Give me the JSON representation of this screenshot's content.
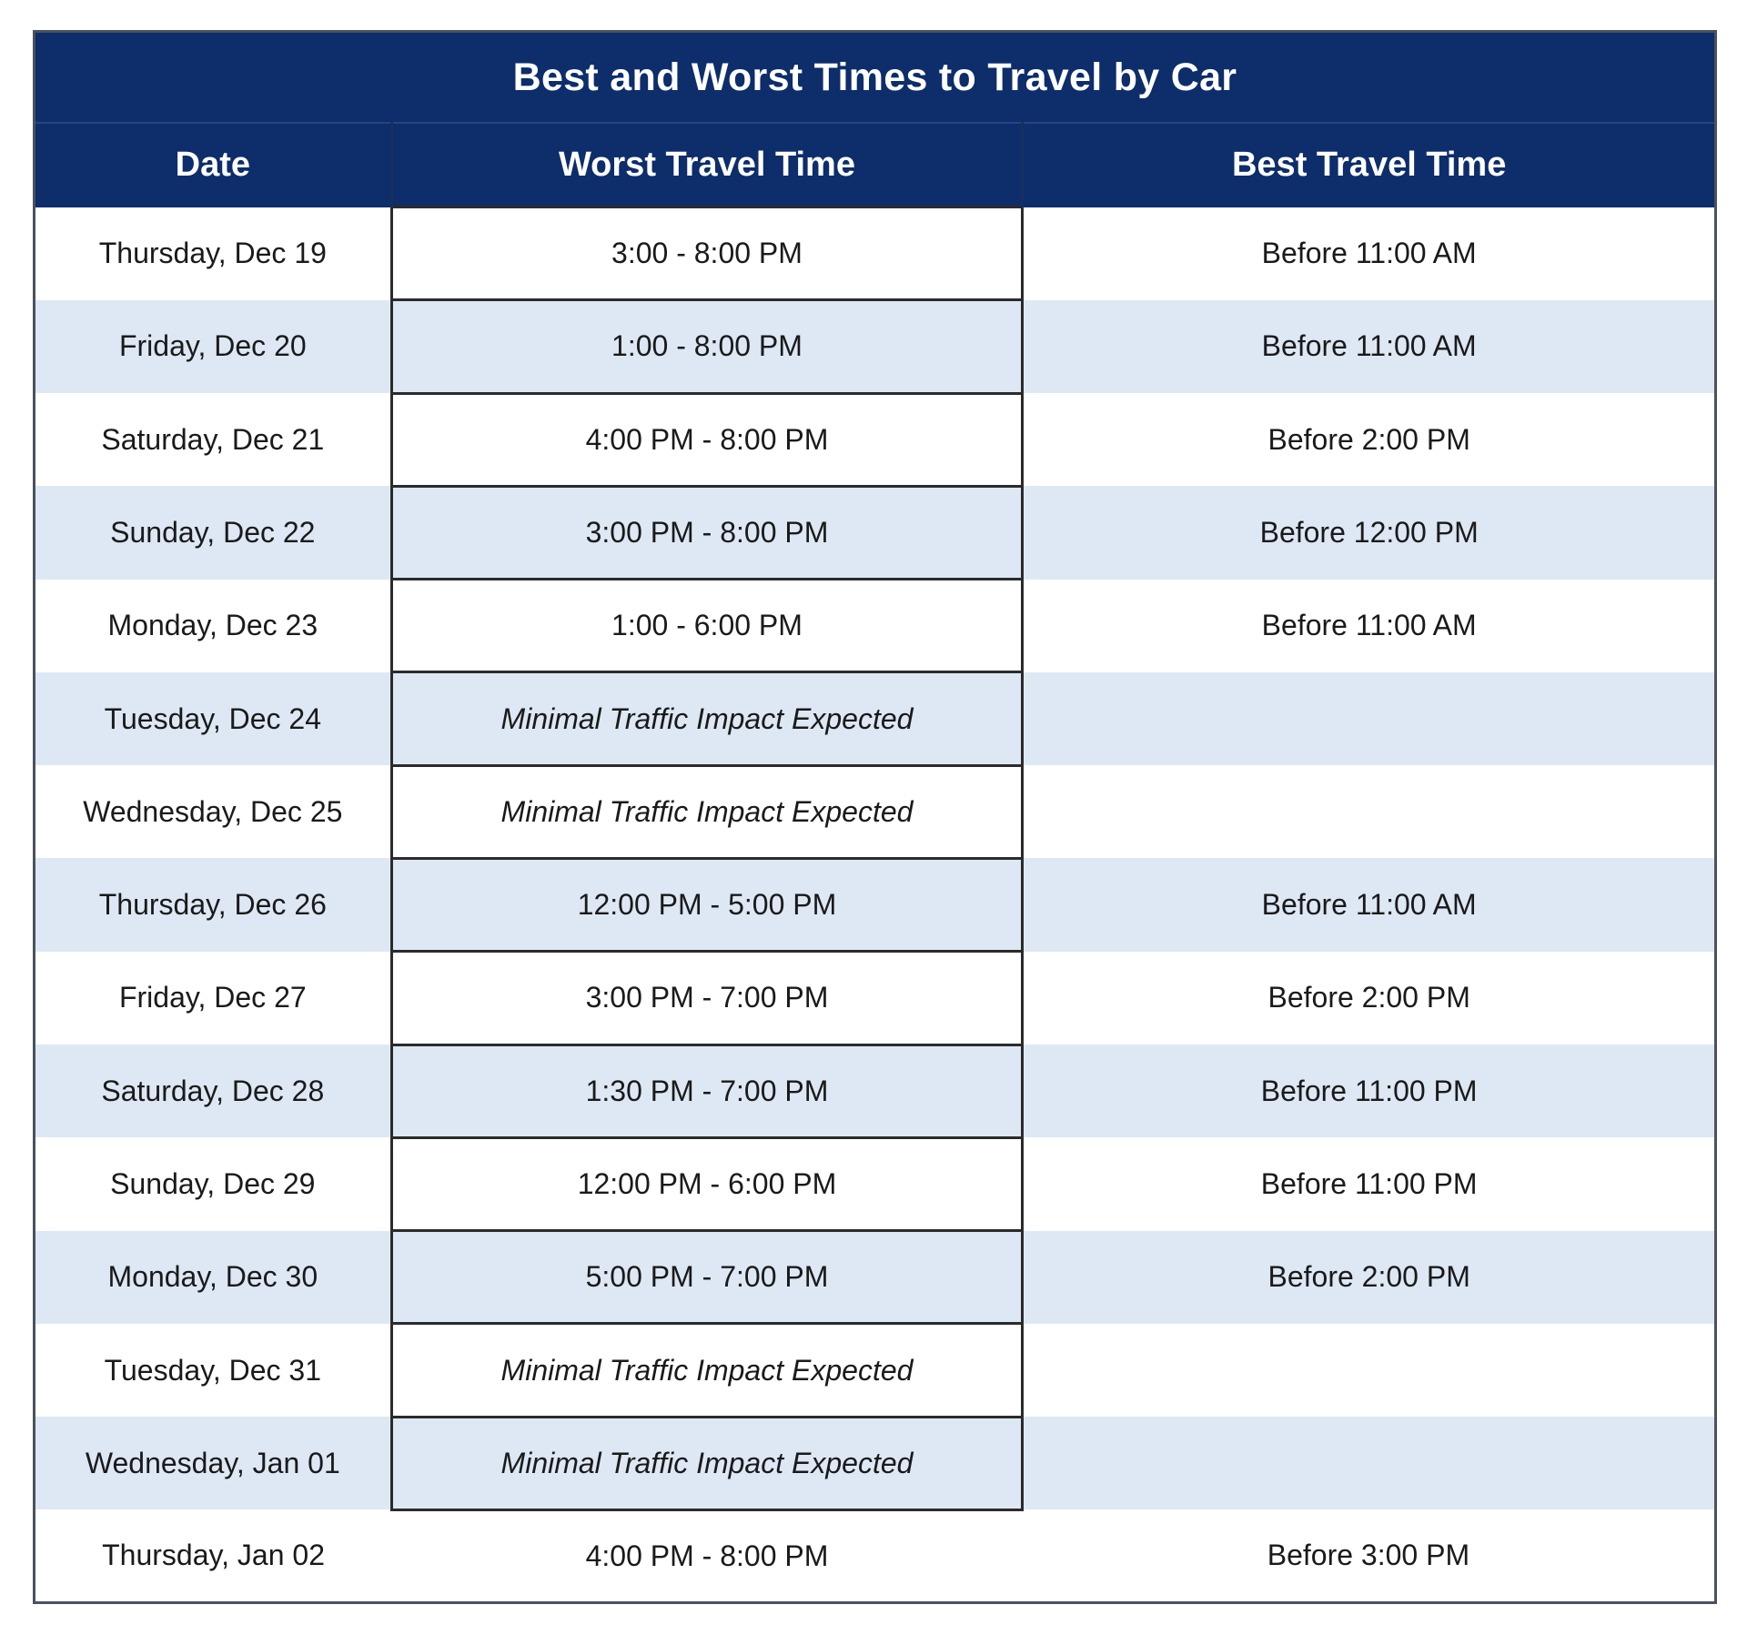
{
  "table": {
    "title": "Best and Worst Times to Travel by Car",
    "columns": {
      "date": "Date",
      "worst": "Worst Travel Time",
      "best": "Best Travel Time"
    },
    "colors": {
      "header_bg": "#0d2d6b",
      "header_text": "#ffffff",
      "band_row_bg": "#dde8f4",
      "plain_row_bg": "#ffffff",
      "body_text": "#1a1a1a",
      "outer_border": "#4a525e",
      "worst_column_border": "#2b2b2b"
    },
    "rows": [
      {
        "date": "Thursday, Dec 19",
        "worst": "3:00 - 8:00 PM",
        "best": "Before 11:00 AM",
        "worst_italic": false
      },
      {
        "date": "Friday, Dec 20",
        "worst": "1:00 - 8:00 PM",
        "best": "Before 11:00 AM",
        "worst_italic": false
      },
      {
        "date": "Saturday, Dec 21",
        "worst": "4:00 PM - 8:00 PM",
        "best": "Before 2:00 PM",
        "worst_italic": false
      },
      {
        "date": "Sunday, Dec 22",
        "worst": "3:00 PM - 8:00 PM",
        "best": "Before 12:00 PM",
        "worst_italic": false
      },
      {
        "date": "Monday, Dec 23",
        "worst": "1:00 - 6:00 PM",
        "best": "Before 11:00 AM",
        "worst_italic": false
      },
      {
        "date": "Tuesday, Dec 24",
        "worst": "Minimal Traffic Impact Expected",
        "best": "",
        "worst_italic": true
      },
      {
        "date": "Wednesday, Dec 25",
        "worst": "Minimal Traffic Impact Expected",
        "best": "",
        "worst_italic": true
      },
      {
        "date": "Thursday, Dec 26",
        "worst": "12:00 PM - 5:00 PM",
        "best": "Before 11:00 AM",
        "worst_italic": false
      },
      {
        "date": "Friday, Dec 27",
        "worst": "3:00 PM - 7:00 PM",
        "best": "Before 2:00 PM",
        "worst_italic": false
      },
      {
        "date": "Saturday, Dec 28",
        "worst": "1:30 PM - 7:00 PM",
        "best": "Before 11:00 PM",
        "worst_italic": false
      },
      {
        "date": "Sunday, Dec 29",
        "worst": "12:00 PM - 6:00 PM",
        "best": "Before 11:00 PM",
        "worst_italic": false
      },
      {
        "date": "Monday, Dec 30",
        "worst": "5:00 PM - 7:00 PM",
        "best": "Before 2:00 PM",
        "worst_italic": false
      },
      {
        "date": "Tuesday, Dec 31",
        "worst": "Minimal Traffic Impact Expected",
        "best": "",
        "worst_italic": true
      },
      {
        "date": "Wednesday, Jan 01",
        "worst": "Minimal Traffic Impact Expected",
        "best": "",
        "worst_italic": true
      },
      {
        "date": "Thursday, Jan 02",
        "worst": "4:00 PM - 8:00 PM",
        "best": "Before 3:00 PM",
        "worst_italic": false
      }
    ]
  }
}
